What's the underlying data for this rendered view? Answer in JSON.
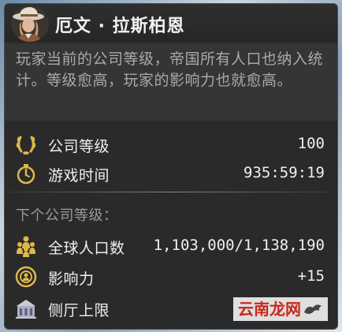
{
  "header": {
    "title": "厄文 · 拉斯柏恩",
    "avatar_icon": "character-portrait"
  },
  "description": "玩家当前的公司等级，帝国所有人口也纳入统计。等级愈高，玩家的影响力也就愈高。",
  "stats": {
    "company_level": {
      "icon": "laurel-icon",
      "label": "公司等级",
      "value": "100"
    },
    "play_time": {
      "icon": "stopwatch-icon",
      "label": "游戏时间",
      "value": "935:59:19"
    }
  },
  "next_level": {
    "section_label": "下个公司等级：",
    "global_population": {
      "icon": "population-icon",
      "label": "全球人口数",
      "value": "1,103,000/1,138,190"
    },
    "influence": {
      "icon": "influence-icon",
      "label": "影响力",
      "value": "+15"
    },
    "side_hall_limit": {
      "icon": "side-hall-icon",
      "label": "侧厅上限",
      "value": ""
    }
  },
  "watermark": {
    "text": "云南龙网"
  },
  "colors": {
    "panel_bg": "#2a2a2a",
    "desc_bg": "#353535",
    "text": "#ececec",
    "desc_text": "#a9a9a9",
    "gold_icon": "#e0b84a",
    "watermark_red": "#c8281c"
  }
}
